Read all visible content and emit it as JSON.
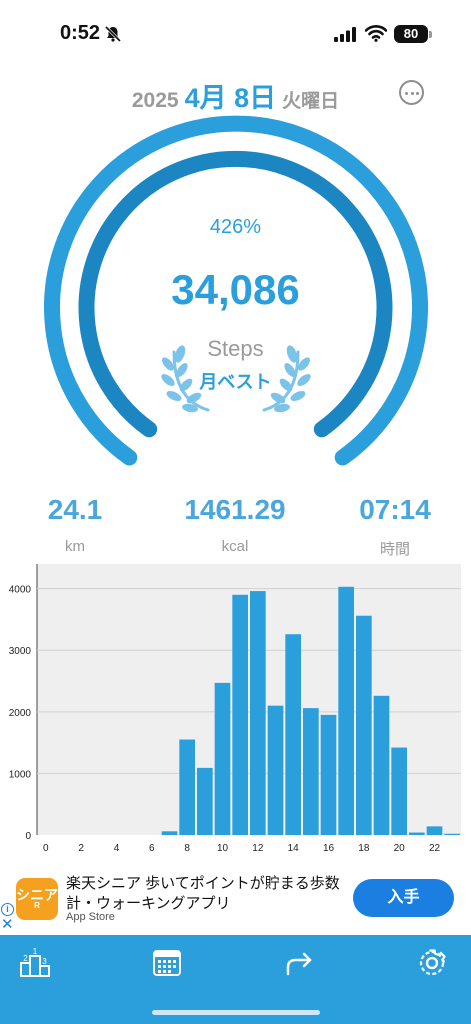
{
  "status_bar": {
    "time": "0:52",
    "battery": "80",
    "icons": [
      "bell-slash-icon",
      "cellular-signal-icon",
      "wifi-icon",
      "battery-icon"
    ]
  },
  "header": {
    "year": "2025",
    "date": "4月 8日",
    "weekday": "火曜日",
    "more_icon": "ellipsis-circle-icon"
  },
  "progress": {
    "percent_label": "426%",
    "steps": "34,086",
    "steps_label": "Steps",
    "badge": "月ベスト",
    "badge_icon": "laurel-wreath-icon"
  },
  "stats": [
    {
      "value": "24.1",
      "unit": "km"
    },
    {
      "value": "1461.29",
      "unit": "kcal"
    },
    {
      "value": "07:14",
      "unit": "時間"
    }
  ],
  "chart_data": {
    "type": "bar",
    "x": [
      0,
      1,
      2,
      3,
      4,
      5,
      6,
      7,
      8,
      9,
      10,
      11,
      12,
      13,
      14,
      15,
      16,
      17,
      18,
      19,
      20,
      21,
      22,
      23
    ],
    "values": [
      0,
      0,
      0,
      0,
      0,
      0,
      0,
      60,
      1550,
      1090,
      2470,
      3900,
      3960,
      2100,
      3260,
      2060,
      1950,
      4030,
      3560,
      2260,
      1420,
      40,
      140,
      20
    ],
    "x_tick_labels": [
      "0",
      "2",
      "4",
      "6",
      "8",
      "10",
      "12",
      "14",
      "16",
      "18",
      "20",
      "22"
    ],
    "y_tick_labels": [
      "0",
      "1000",
      "2000",
      "3000",
      "4000"
    ],
    "ylim": [
      0,
      4400
    ],
    "grid": true,
    "bar_color": "#2a9fdc",
    "background_color": "#efefef"
  },
  "ad": {
    "logo_text": "シニア",
    "logo_sub": "R",
    "title": "楽天シニア 歩いてポイントが貯まる歩数計・ウォーキングアプリ",
    "source": "App Store",
    "install_label": "入手",
    "info_icon": "info-icon",
    "close_icon": "close-icon"
  },
  "tabbar": {
    "color": "#2a9fdc",
    "items": [
      "ranking-podium-icon",
      "calendar-icon",
      "share-arrow-icon",
      "settings-gear-icon"
    ]
  },
  "colors": {
    "accent": "#2a9fdc",
    "ring_inner": "#1c86c2",
    "text_muted": "#9a9a9a"
  }
}
